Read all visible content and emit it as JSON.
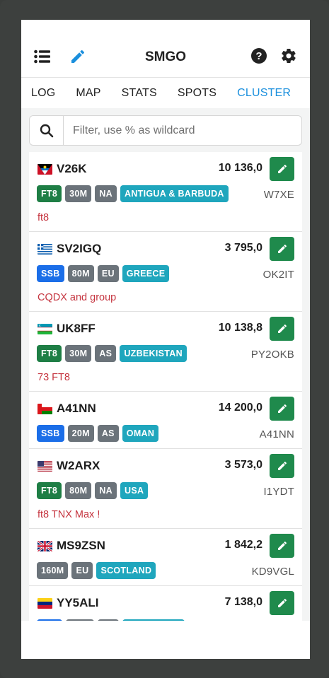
{
  "header": {
    "title": "SMGO"
  },
  "tabs": [
    {
      "label": "LOG",
      "active": false
    },
    {
      "label": "MAP",
      "active": false
    },
    {
      "label": "STATS",
      "active": false
    },
    {
      "label": "SPOTS",
      "active": false
    },
    {
      "label": "CLUSTER",
      "active": true
    }
  ],
  "search": {
    "placeholder": "Filter, use % as wildcard",
    "value": ""
  },
  "spots": [
    {
      "call": "V26K",
      "freq": "10 136,0",
      "mode": "FT8",
      "band": "30M",
      "continent": "NA",
      "country": "ANTIGUA & BARBUDA",
      "spotter": "W7XE",
      "comment": "ft8",
      "flag": "antigua-flag"
    },
    {
      "call": "SV2IGQ",
      "freq": "3 795,0",
      "mode": "SSB",
      "band": "80M",
      "continent": "EU",
      "country": "GREECE",
      "spotter": "OK2IT",
      "comment": "CQDX and group",
      "flag": "greece-flag"
    },
    {
      "call": "UK8FF",
      "freq": "10 138,8",
      "mode": "FT8",
      "band": "30M",
      "continent": "AS",
      "country": "UZBEKISTAN",
      "spotter": "PY2OKB",
      "comment": "73 FT8",
      "flag": "uzbekistan-flag"
    },
    {
      "call": "A41NN",
      "freq": "14 200,0",
      "mode": "SSB",
      "band": "20M",
      "continent": "AS",
      "country": "OMAN",
      "spotter": "A41NN",
      "comment": "",
      "flag": "oman-flag"
    },
    {
      "call": "W2ARX",
      "freq": "3 573,0",
      "mode": "FT8",
      "band": "80M",
      "continent": "NA",
      "country": "USA",
      "spotter": "I1YDT",
      "comment": "ft8 TNX Max !",
      "flag": "usa-flag"
    },
    {
      "call": "MS9ZSN",
      "freq": "1 842,2",
      "mode": "",
      "band": "160M",
      "continent": "EU",
      "country": "SCOTLAND",
      "spotter": "KD9VGL",
      "comment": "",
      "flag": "uk-flag"
    },
    {
      "call": "YY5ALI",
      "freq": "7 138,0",
      "mode": "",
      "band": "",
      "continent": "",
      "country": "",
      "spotter": "",
      "comment": "",
      "flag": "venezuela-flag"
    }
  ],
  "colors": {
    "accent": "#1a8fdd",
    "ft8": "#1e7e45",
    "ssb": "#1b6ee8",
    "gray": "#6b737a",
    "country": "#1fa6bd",
    "edit": "#1f8a4c",
    "comment": "#c5343f"
  }
}
